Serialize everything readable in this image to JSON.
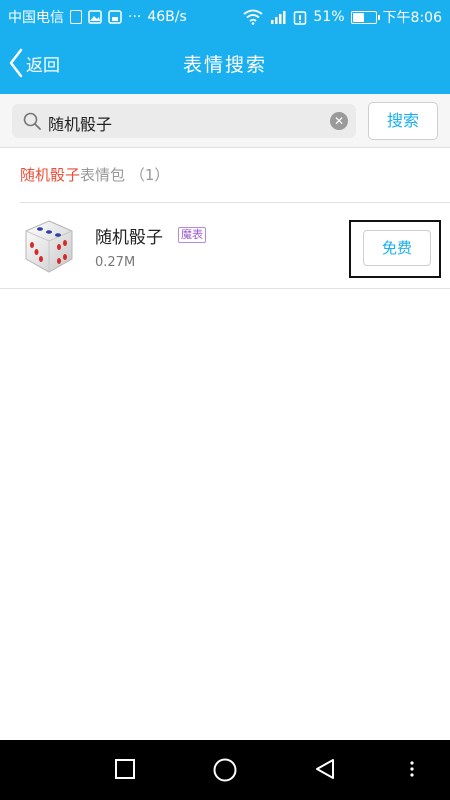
{
  "status_bar": {
    "carrier": "中国电信",
    "speed": "46B/s",
    "dots": "···",
    "battery_percent": "51%",
    "battery_level": 0.51,
    "time": "下午8:06",
    "icons": [
      "sim-icon",
      "image-icon",
      "save-icon",
      "wifi-icon",
      "signal-4g-icon",
      "alarm-icon",
      "battery-icon"
    ]
  },
  "navbar": {
    "back_label": "返回",
    "title": "表情搜索"
  },
  "search": {
    "query": "随机骰子",
    "clear_icon": "clear-icon",
    "button_label": "搜索"
  },
  "results": {
    "header_keyword": "随机骰子",
    "header_type": "表情包",
    "header_count": "（1）",
    "items": [
      {
        "name": "随机骰子",
        "badge": "魔表",
        "size": "0.27M",
        "action": "免费",
        "thumbnail": "dice-icon"
      }
    ]
  },
  "system_nav": [
    "recent-apps-button",
    "home-button",
    "back-nav-button",
    "menu-button"
  ],
  "colors": {
    "accent": "#1ab0f0",
    "highlight": "#e8503a",
    "badge": "#9b59d0"
  }
}
